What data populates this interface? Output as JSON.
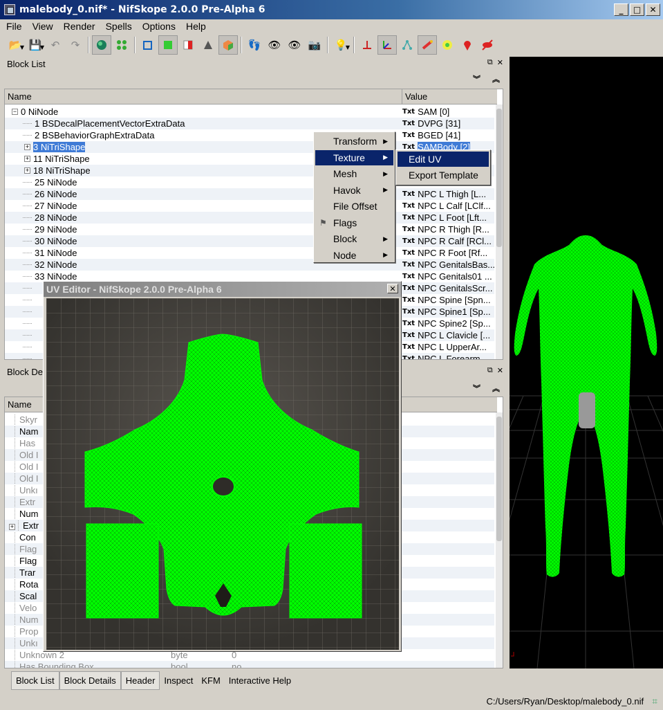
{
  "window": {
    "title": "malebody_0.nif* - NifSkope 2.0.0 Pre-Alpha 6"
  },
  "menu": [
    "File",
    "View",
    "Render",
    "Spells",
    "Options",
    "Help"
  ],
  "block_list": {
    "title": "Block List",
    "col_name": "Name",
    "col_value": "Value",
    "rows": [
      {
        "name": "0 NiNode",
        "value": "SAM [0]",
        "indent": 0,
        "expander": "−"
      },
      {
        "name": "1 BSDecalPlacementVectorExtraData",
        "value": "DVPG [31]",
        "indent": 1,
        "expander": ""
      },
      {
        "name": "2 BSBehaviorGraphExtraData",
        "value": "BGED [41]",
        "indent": 1,
        "expander": ""
      },
      {
        "name": "3 NiTriShape",
        "value": "SAMBody [2]",
        "indent": 1,
        "expander": "+",
        "selected": true
      },
      {
        "name": "11 NiTriShape",
        "value": "",
        "indent": 1,
        "expander": "+"
      },
      {
        "name": "18 NiTriShape",
        "value": "",
        "indent": 1,
        "expander": "+"
      },
      {
        "name": "25 NiNode",
        "value": "",
        "indent": 1,
        "expander": ""
      },
      {
        "name": "26 NiNode",
        "value": "NPC L Thigh [L...",
        "indent": 1,
        "expander": ""
      },
      {
        "name": "27 NiNode",
        "value": "NPC L Calf [LClf...",
        "indent": 1,
        "expander": ""
      },
      {
        "name": "28 NiNode",
        "value": "NPC L Foot [Lft...",
        "indent": 1,
        "expander": ""
      },
      {
        "name": "29 NiNode",
        "value": "NPC R Thigh [R...",
        "indent": 1,
        "expander": ""
      },
      {
        "name": "30 NiNode",
        "value": "NPC R Calf [RCl...",
        "indent": 1,
        "expander": ""
      },
      {
        "name": "31 NiNode",
        "value": "NPC R Foot [Rf...",
        "indent": 1,
        "expander": ""
      },
      {
        "name": "32 NiNode",
        "value": "NPC GenitalsBas...",
        "indent": 1,
        "expander": ""
      },
      {
        "name": "33 NiNode",
        "value": "NPC Genitals01 ...",
        "indent": 1,
        "expander": ""
      },
      {
        "name": "",
        "value": "NPC GenitalsScr...",
        "indent": 1,
        "expander": ""
      },
      {
        "name": "",
        "value": "NPC Spine [Spn...",
        "indent": 1,
        "expander": ""
      },
      {
        "name": "",
        "value": "NPC Spine1 [Sp...",
        "indent": 1,
        "expander": ""
      },
      {
        "name": "",
        "value": "NPC Spine2 [Sp...",
        "indent": 1,
        "expander": ""
      },
      {
        "name": "",
        "value": "NPC L Clavicle [...",
        "indent": 1,
        "expander": ""
      },
      {
        "name": "",
        "value": "NPC L UpperAr...",
        "indent": 1,
        "expander": ""
      },
      {
        "name": "",
        "value": "NPC L Forearm",
        "indent": 1,
        "expander": ""
      }
    ],
    "txt_tag": "Txt"
  },
  "block_details": {
    "title": "Block Det",
    "col_name": "Name",
    "rows": [
      {
        "name": "Skyr",
        "grey": true
      },
      {
        "name": "Nam",
        "grey": false
      },
      {
        "name": "Has",
        "grey": true
      },
      {
        "name": "Old I",
        "grey": true
      },
      {
        "name": "Old I",
        "grey": true
      },
      {
        "name": "Old I",
        "grey": true
      },
      {
        "name": "Unkı",
        "grey": true
      },
      {
        "name": "Extr",
        "grey": true
      },
      {
        "name": "Num",
        "grey": false
      },
      {
        "name": "Extr",
        "grey": false,
        "expander": "+"
      },
      {
        "name": "Con",
        "grey": false
      },
      {
        "name": "Flag",
        "grey": true
      },
      {
        "name": "Flag",
        "grey": false
      },
      {
        "name": "Trar",
        "grey": false
      },
      {
        "name": "Rota",
        "grey": false
      },
      {
        "name": "Scal",
        "grey": false
      },
      {
        "name": "Velo",
        "grey": true
      },
      {
        "name": "Num",
        "grey": true
      },
      {
        "name": "Prop",
        "grey": true
      },
      {
        "name": "Unkı",
        "grey": true
      },
      {
        "name": "Unknown 2",
        "type": "byte",
        "value": "0",
        "grey": true
      },
      {
        "name": "Has Bounding Box",
        "type": "bool",
        "value": "no",
        "grey": true
      }
    ]
  },
  "context_menu": {
    "items": [
      {
        "label": "Transform",
        "submenu": true
      },
      {
        "label": "Texture",
        "submenu": true,
        "highlighted": true
      },
      {
        "label": "Mesh",
        "submenu": true
      },
      {
        "label": "Havok",
        "submenu": true
      },
      {
        "label": "File Offset",
        "submenu": false
      },
      {
        "label": "Flags",
        "submenu": false,
        "icon": "flag-icon"
      },
      {
        "label": "Block",
        "submenu": true
      },
      {
        "label": "Node",
        "submenu": true
      }
    ],
    "submenu": [
      {
        "label": "Edit UV",
        "highlighted": true
      },
      {
        "label": "Export Template"
      }
    ]
  },
  "uv_editor": {
    "title": "UV Editor - NifSkope 2.0.0 Pre-Alpha 6",
    "mesh_color": "#00ff00"
  },
  "tabs": [
    "Block List",
    "Block Details",
    "Header",
    "Inspect",
    "KFM",
    "Interactive Help"
  ],
  "status": {
    "path": "C:/Users/Ryan/Desktop/malebody_0.nif"
  },
  "colors": {
    "selection": "#3f7bd6",
    "menu_highlight": "#0a246a",
    "mesh": "#00ff00"
  }
}
